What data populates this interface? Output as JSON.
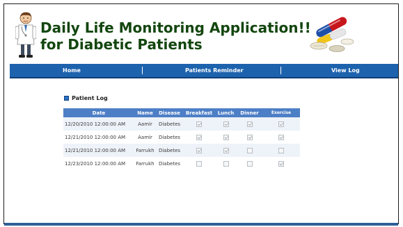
{
  "app": {
    "title": "Daily Life Monitoring Application!!\nfor Diabetic Patients"
  },
  "nav": {
    "items": [
      {
        "label": "Home"
      },
      {
        "label": "Patients Reminder"
      },
      {
        "label": "View Log"
      }
    ]
  },
  "section": {
    "title": "Patient Log"
  },
  "table": {
    "columns": [
      "Date",
      "Name",
      "Disease",
      "Breakfast",
      "Lunch",
      "Dinner",
      "Exercise"
    ],
    "rows": [
      {
        "date": "12/20/2010 12:00:00 AM",
        "name": "Aamir",
        "disease": "Diabetes",
        "breakfast": true,
        "lunch": true,
        "dinner": true,
        "exercise": true
      },
      {
        "date": "12/21/2010 12:00:00 AM",
        "name": "Aamir",
        "disease": "Diabetes",
        "breakfast": true,
        "lunch": true,
        "dinner": true,
        "exercise": true
      },
      {
        "date": "12/21/2010 12:00:00 AM",
        "name": "Farrukh",
        "disease": "Diabetes",
        "breakfast": true,
        "lunch": true,
        "dinner": false,
        "exercise": false
      },
      {
        "date": "12/23/2010 12:00:00 AM",
        "name": "Farrukh",
        "disease": "Diabetes",
        "breakfast": false,
        "lunch": false,
        "dinner": false,
        "exercise": true
      }
    ]
  },
  "icons": {
    "logo": "doctor-icon",
    "illustration": "pills-icon",
    "section": "square-bullet-icon",
    "checkbox": "checkbox-icon"
  },
  "colors": {
    "title": "#13460f",
    "navbar": "#1d62ad",
    "table_header": "#4d7fc6",
    "row_alt": "#eef3f9"
  }
}
